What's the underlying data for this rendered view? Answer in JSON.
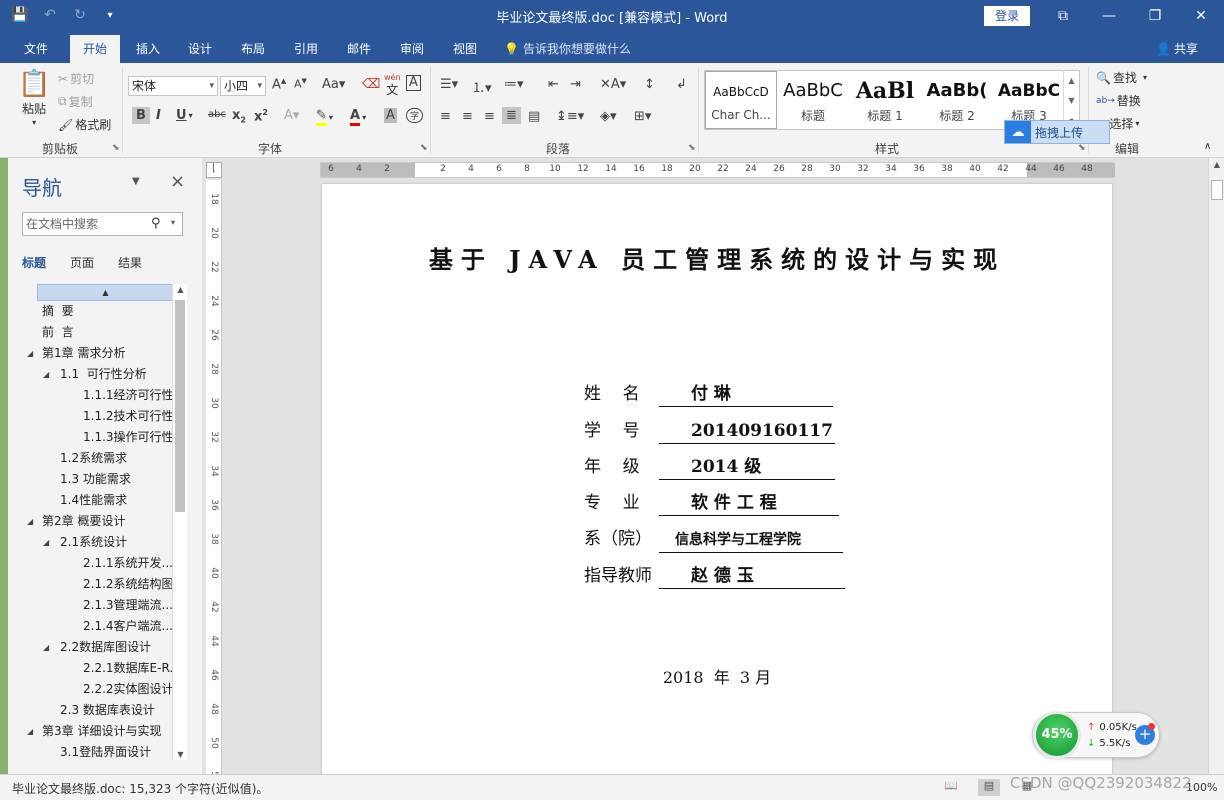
{
  "window": {
    "title": "毕业论文最终版.doc [兼容模式]  -  Word",
    "login_label": "登录",
    "controls": {
      "restore_ribbon": "⧉",
      "minimize": "—",
      "maximize": "❐",
      "close": "✕"
    }
  },
  "qat": {
    "save_icon": "💾",
    "undo_icon": "↶",
    "redo_icon": "↻",
    "customize_icon": "▾"
  },
  "tabs": [
    {
      "label": "文件"
    },
    {
      "label": "开始"
    },
    {
      "label": "插入"
    },
    {
      "label": "设计"
    },
    {
      "label": "布局"
    },
    {
      "label": "引用"
    },
    {
      "label": "邮件"
    },
    {
      "label": "审阅"
    },
    {
      "label": "视图"
    }
  ],
  "active_tab": "开始",
  "tell_me": "告诉我你想要做什么",
  "share_label": "共享",
  "ribbon": {
    "clipboard": {
      "label": "剪贴板",
      "paste": "粘贴",
      "cut": "剪切",
      "copy": "复制",
      "format_painter": "格式刷"
    },
    "font": {
      "label": "字体",
      "font_name": "宋体",
      "font_size": "小四",
      "wen_label": "wén"
    },
    "paragraph": {
      "label": "段落"
    },
    "styles": {
      "label": "样式",
      "items": [
        {
          "preview": "AaBbCcD",
          "name": "Char Ch..."
        },
        {
          "preview": "AaBbC",
          "name": "标题"
        },
        {
          "preview": "AaBl",
          "name": "标题 1"
        },
        {
          "preview": "AaBb(",
          "name": "标题 2"
        },
        {
          "preview": "AaBbC",
          "name": "标题 3"
        }
      ]
    },
    "editing": {
      "label": "编辑",
      "find": "查找",
      "replace": "替换",
      "select": "选择"
    },
    "upload_popup": "拖拽上传"
  },
  "navigation": {
    "title": "导航",
    "search_placeholder": "在文档中搜索",
    "tabs": [
      "标题",
      "页面",
      "结果"
    ],
    "active_tab": "标题",
    "items": [
      {
        "text": "摘  要",
        "level": 1,
        "expander": false
      },
      {
        "text": "前  言",
        "level": 1,
        "expander": false
      },
      {
        "text": "第1章 需求分析",
        "level": 1,
        "expander": true
      },
      {
        "text": "1.1  可行性分析",
        "level": 2,
        "expander": true
      },
      {
        "text": "1.1.1经济可行性",
        "level": 3,
        "expander": false
      },
      {
        "text": "1.1.2技术可行性",
        "level": 3,
        "expander": false
      },
      {
        "text": "1.1.3操作可行性",
        "level": 3,
        "expander": false
      },
      {
        "text": "1.2系统需求",
        "level": 2,
        "expander": false
      },
      {
        "text": "1.3 功能需求",
        "level": 2,
        "expander": false
      },
      {
        "text": "1.4性能需求",
        "level": 2,
        "expander": false
      },
      {
        "text": "第2章 概要设计",
        "level": 1,
        "expander": true
      },
      {
        "text": "2.1系统设计",
        "level": 2,
        "expander": true
      },
      {
        "text": "2.1.1系统开发...",
        "level": 3,
        "expander": false
      },
      {
        "text": "2.1.2系统结构图",
        "level": 3,
        "expander": false
      },
      {
        "text": "2.1.3管理端流...",
        "level": 3,
        "expander": false
      },
      {
        "text": "2.1.4客户端流...",
        "level": 3,
        "expander": false
      },
      {
        "text": "2.2数据库图设计",
        "level": 2,
        "expander": true
      },
      {
        "text": "2.2.1数据库E-R...",
        "level": 3,
        "expander": false
      },
      {
        "text": "2.2.2实体图设计",
        "level": 3,
        "expander": false
      },
      {
        "text": "2.3 数据库表设计",
        "level": 2,
        "expander": false
      },
      {
        "text": "第3章 详细设计与实现",
        "level": 1,
        "expander": true
      },
      {
        "text": "3.1登陆界面设计",
        "level": 2,
        "expander": false
      }
    ]
  },
  "rulers": {
    "horizontal": [
      "6",
      "4",
      "2",
      "2",
      "4",
      "6",
      "8",
      "10",
      "12",
      "14",
      "16",
      "18",
      "20",
      "22",
      "24",
      "26",
      "28",
      "30",
      "32",
      "34",
      "36",
      "38",
      "40",
      "42",
      "44",
      "46",
      "48"
    ],
    "vertical": [
      "18",
      "20",
      "22",
      "24",
      "26",
      "28",
      "30",
      "32",
      "34",
      "36",
      "38",
      "40",
      "42",
      "44",
      "46",
      "48",
      "50",
      "52"
    ]
  },
  "document": {
    "title": "基于 JAVA 员工管理系统的设计与实现",
    "fields": [
      {
        "label": "姓    名",
        "value": "付  琳"
      },
      {
        "label": "学    号",
        "value": "201409160117"
      },
      {
        "label": "年    级",
        "value": "2014 级"
      },
      {
        "label": "专    业",
        "value": "软 件 工 程"
      },
      {
        "label": "系（院）",
        "value": "信息科学与工程学院"
      },
      {
        "label": "指导教师",
        "value": "赵 德 玉"
      }
    ],
    "date": "2018  年  3 月"
  },
  "status": {
    "text": "毕业论文最终版.doc: 15,323 个字符(近似值)。",
    "zoom": "100%",
    "watermark": "CSDN @QQ2392034822"
  },
  "network_widget": {
    "percent": "45%",
    "upload": "0.05K/s",
    "download": "5.5K/s",
    "up_arrow": "↑",
    "down_arrow": "↓",
    "plus": "+"
  },
  "colors": {
    "brand": "#2b579a",
    "ribbon_bg": "#f3f3f3",
    "nav_title": "#2b579a"
  }
}
